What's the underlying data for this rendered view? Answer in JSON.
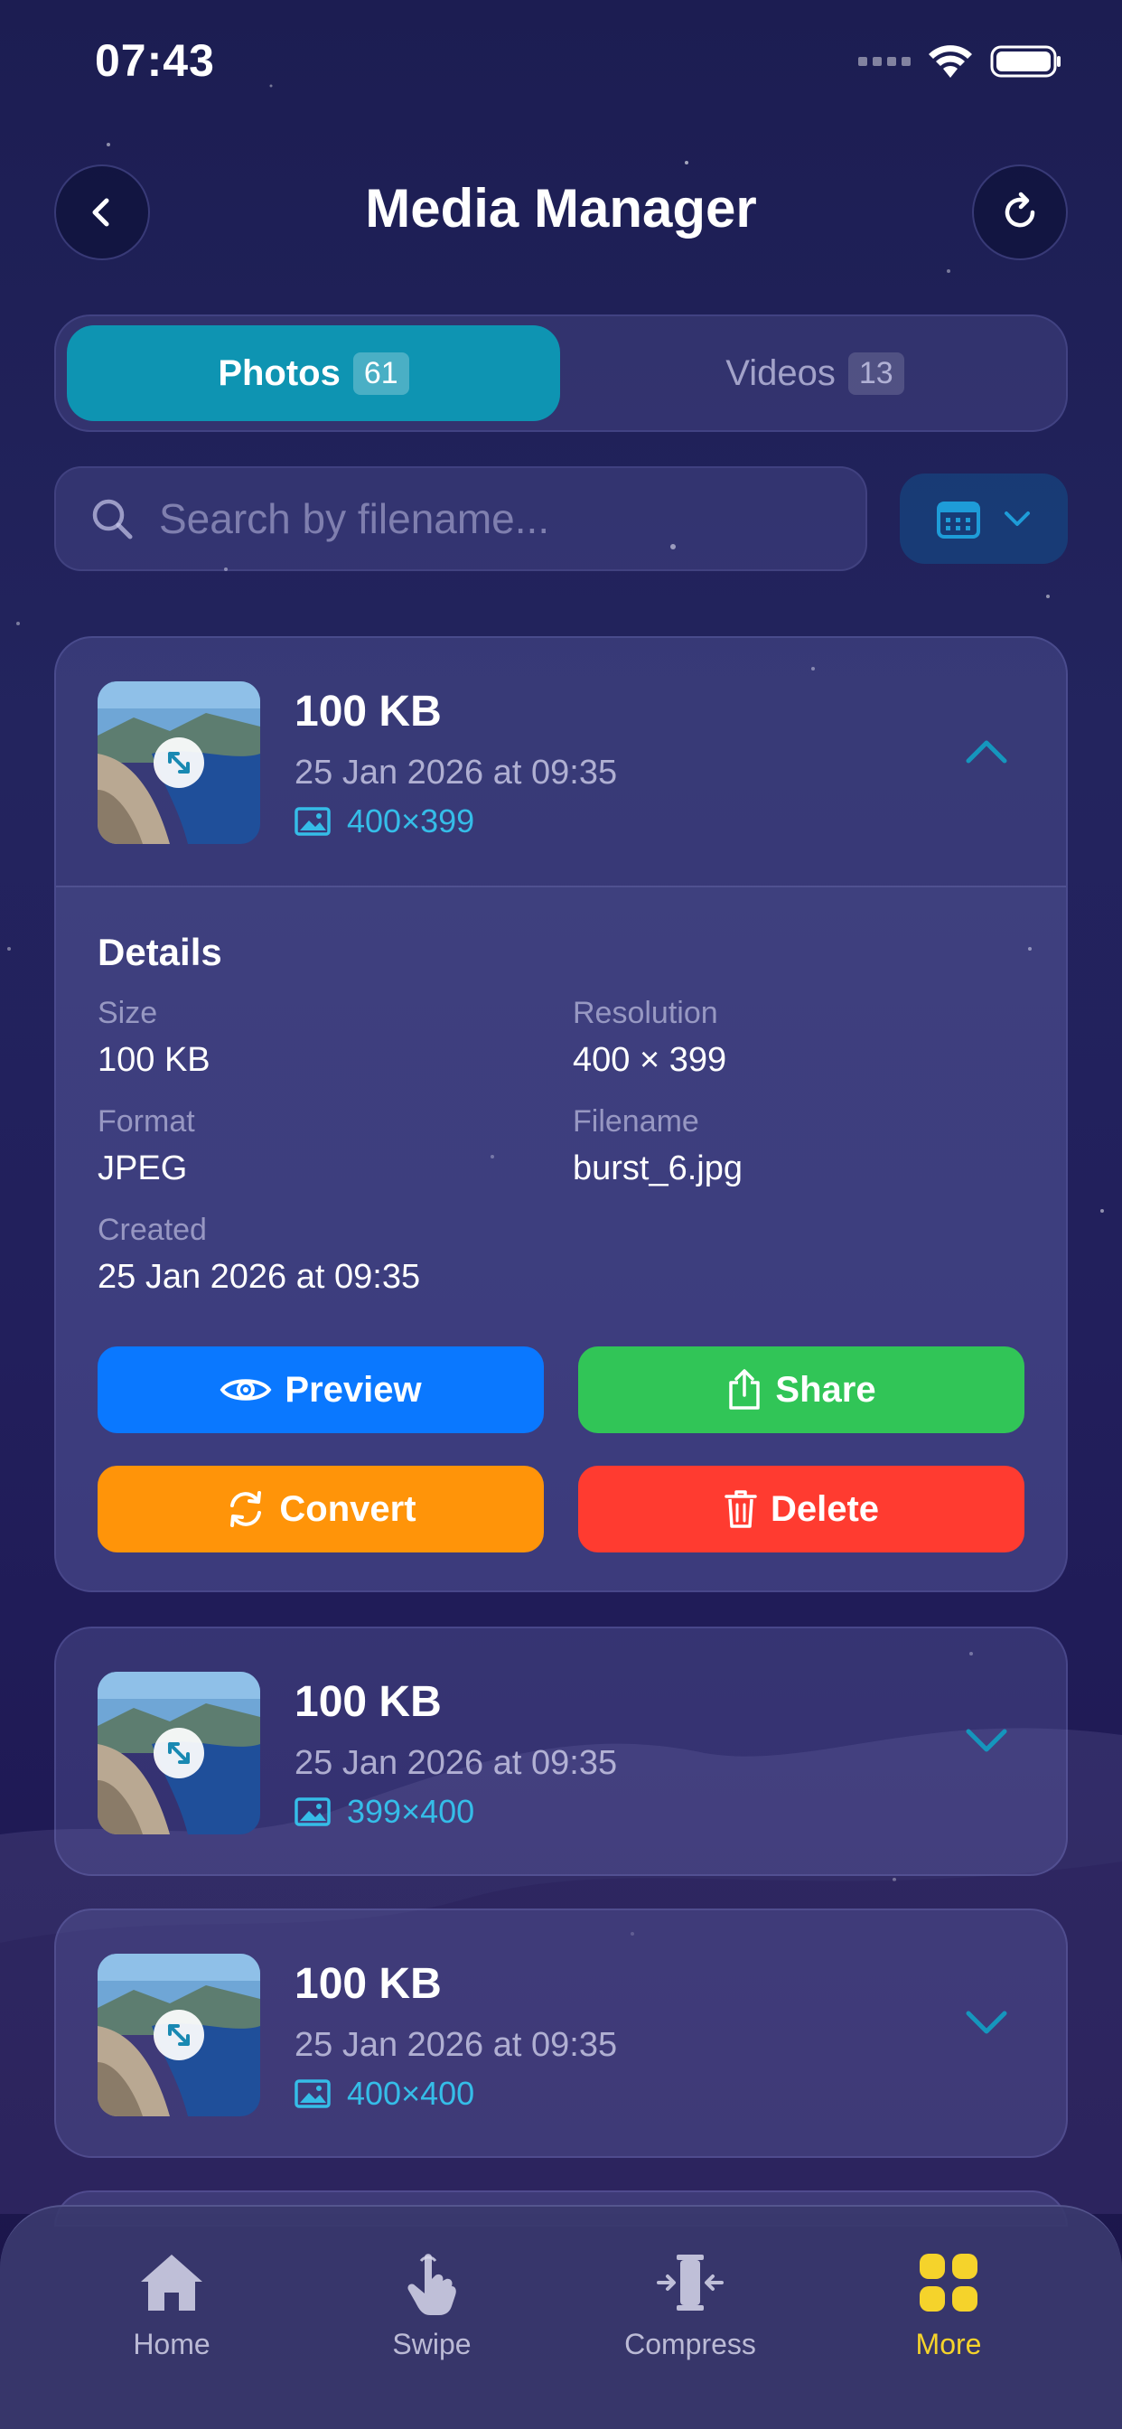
{
  "status_bar": {
    "time": "07:43"
  },
  "header": {
    "title": "Media Manager"
  },
  "segments": {
    "photos_label": "Photos",
    "photos_count": "61",
    "videos_label": "Videos",
    "videos_count": "13"
  },
  "search": {
    "placeholder": "Search by filename..."
  },
  "cards": [
    {
      "size": "100 KB",
      "date": "25 Jan 2026 at 09:35",
      "resolution": "400×399",
      "expanded": true,
      "details": {
        "title": "Details",
        "size_label": "Size",
        "size_value": "100 KB",
        "resolution_label": "Resolution",
        "resolution_value": "400 × 399",
        "format_label": "Format",
        "format_value": "JPEG",
        "filename_label": "Filename",
        "filename_value": "burst_6.jpg",
        "created_label": "Created",
        "created_value": "25 Jan 2026 at 09:35"
      },
      "actions": {
        "preview": "Preview",
        "share": "Share",
        "convert": "Convert",
        "delete": "Delete"
      }
    },
    {
      "size": "100 KB",
      "date": "25 Jan 2026 at 09:35",
      "resolution": "399×400",
      "expanded": false
    },
    {
      "size": "100 KB",
      "date": "25 Jan 2026 at 09:35",
      "resolution": "400×400",
      "expanded": false
    }
  ],
  "tabbar": {
    "home": "Home",
    "swipe": "Swipe",
    "compress": "Compress",
    "more": "More",
    "active": "More"
  },
  "colors": {
    "accent": "#0e94b2",
    "resolution_text": "#35bde8",
    "preview": "#0a78ff",
    "share": "#31c557",
    "convert": "#ff9409",
    "delete": "#ff3b30",
    "active_tab": "#f5d32b"
  },
  "icons": [
    "back-icon",
    "refresh-icon",
    "search-icon",
    "calendar-icon",
    "chevron-down-icon",
    "chevron-up-icon",
    "image-icon",
    "expand-icon",
    "eye-icon",
    "share-icon",
    "convert-icon",
    "trash-icon",
    "home-icon",
    "swipe-icon",
    "compress-icon",
    "more-icon"
  ]
}
